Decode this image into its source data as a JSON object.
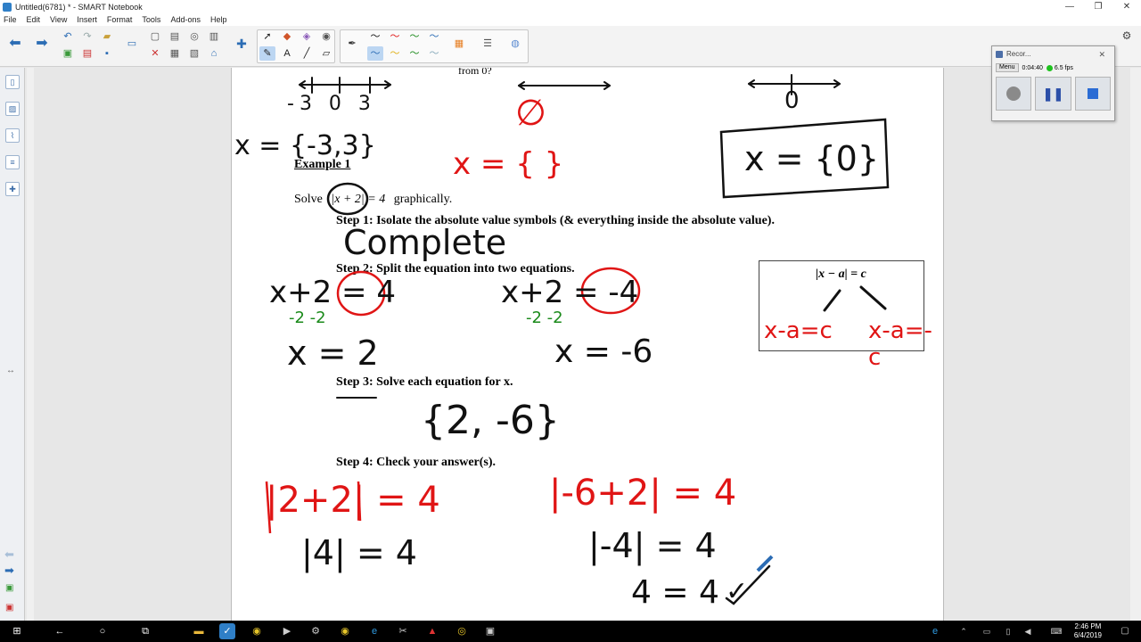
{
  "window": {
    "title": "Untitled(6781) * - SMART Notebook",
    "minimize": "—",
    "restore": "❐",
    "close": "✕"
  },
  "menu": [
    "File",
    "Edit",
    "View",
    "Insert",
    "Format",
    "Tools",
    "Add-ons",
    "Help"
  ],
  "recorder": {
    "title": "Recor...",
    "menu_label": "Menu",
    "time": "0:04:40",
    "fps": "6.5 fps"
  },
  "taskbar": {
    "time": "2:46 PM",
    "date": "6/4/2019"
  },
  "page": {
    "top_question_fragment": "from 0?",
    "example_title": "Example 1",
    "solve_prefix": "Solve",
    "solve_expr": "|x + 2| = 4",
    "solve_suffix": "graphically.",
    "step1": "Step 1:  Isolate the absolute value symbols (& everything inside the absolute value).",
    "step2": "Step 2:  Split the equation into two equations.",
    "step3": "Step 3:  Solve each equation for x.",
    "step4": "Step 4:  Check your answer(s).",
    "box_formula": "|x − a| = c",
    "ink": {
      "ticks": "-3  0  3",
      "set1": "x = {-3,3}",
      "empty": "∅",
      "set2": "x = {  }",
      "zero": "0",
      "set3": "x = {0}",
      "complete": "Complete",
      "eq_left": "x+2 = 4",
      "eq_right": "x+2 = -4",
      "sub_left": "-2   -2",
      "sub_right": "-2   -2",
      "sol_left": "x = 2",
      "sol_right": "x = -6",
      "solution_set": "{2, -6}",
      "box_left": "x-a=c",
      "box_right": "x-a=-c",
      "check_left1": "|2+2| = 4",
      "check_left2": "|4| = 4",
      "check_right1": "|-6+2| = 4",
      "check_right2": "|-4| = 4",
      "check_right3": "4 = 4",
      "checkmark": "✓"
    }
  },
  "colors": {
    "ink_black": "#111111",
    "ink_red": "#e01515",
    "ink_green": "#1a8a1a",
    "accent": "#2b6cb4"
  }
}
